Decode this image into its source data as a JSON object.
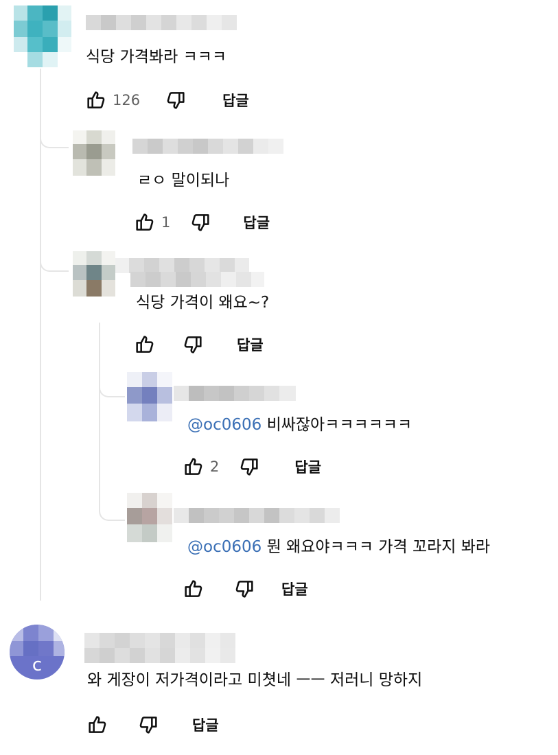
{
  "comments": [
    {
      "text": "식당 가격봐라 ㅋㅋㅋ",
      "likes": "126",
      "reply_label": "답글"
    },
    {
      "text": "ㄹㅇ 말이되나",
      "likes": "1",
      "reply_label": "답글"
    },
    {
      "text": "식당 가격이 왜요~?",
      "likes": "",
      "reply_label": "답글"
    },
    {
      "mention": "@oc0606",
      "text": " 비싸잖아ㅋㅋㅋㅋㅋㅋ",
      "likes": "2",
      "reply_label": "답글"
    },
    {
      "mention": "@oc0606",
      "text": " 뭔 왜요야ㅋㅋㅋ 가격 꼬라지 봐라",
      "likes": "",
      "reply_label": "답글"
    },
    {
      "avatar_letter": "c",
      "text": "와 게장이 저가격이라고 미쳣네 ㅡㅡ 저러니 망하지",
      "likes": "",
      "reply_label": "답글"
    }
  ],
  "icons": {
    "like": "thumbs-up-icon",
    "dislike": "thumbs-down-icon"
  },
  "colors": {
    "mention": "#3a6fb5",
    "avatar_purple": "#6b73c9",
    "avatar_teal": "#4bb6c2"
  }
}
